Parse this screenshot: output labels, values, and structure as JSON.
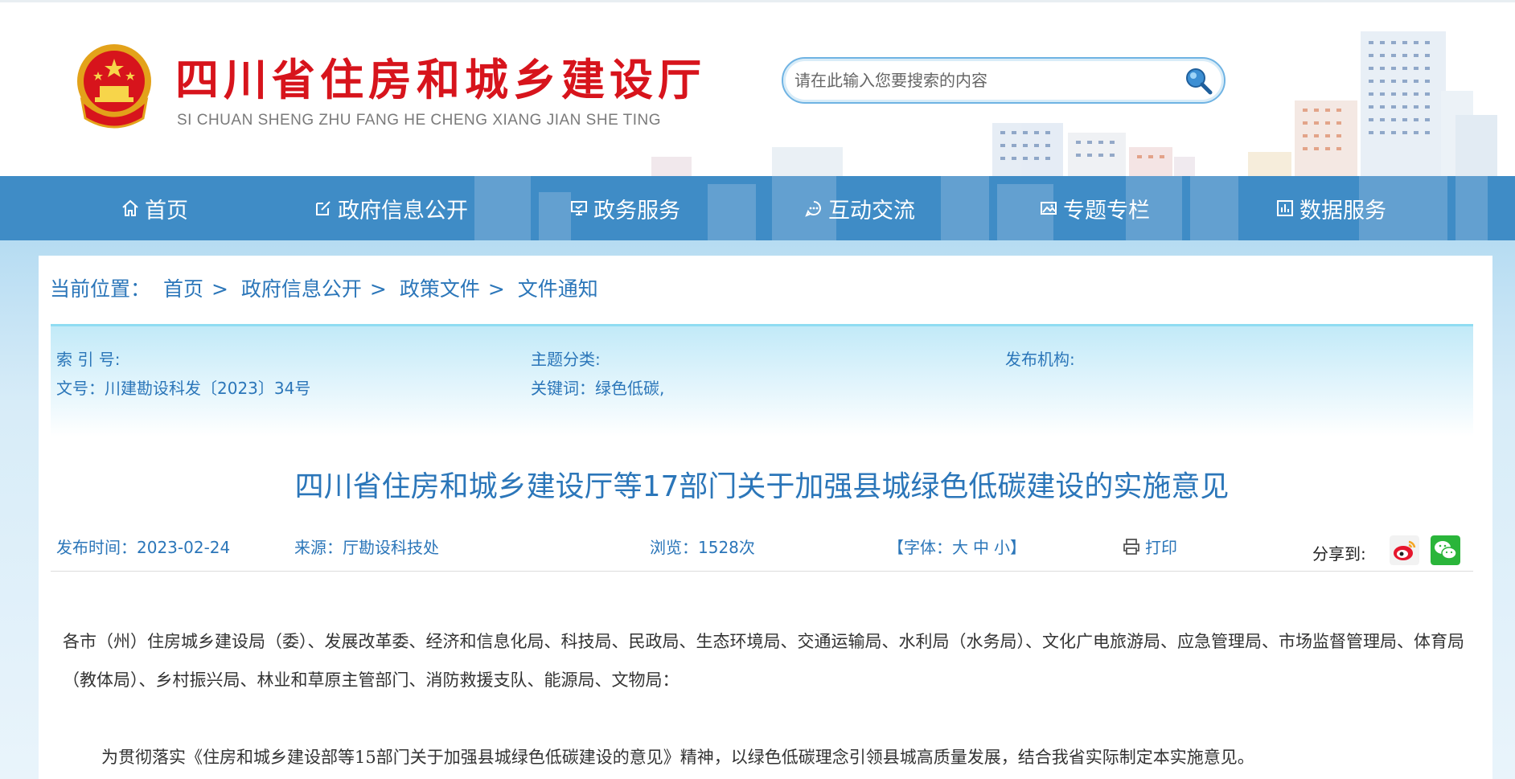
{
  "header": {
    "title": "四川省住房和城乡建设厅",
    "subtitle": "SI CHUAN SHENG ZHU FANG HE CHENG XIANG JIAN SHE TING",
    "search_placeholder": "请在此输入您要搜索的内容",
    "emblem_icon": "national-emblem",
    "search_icon": "magnifier-icon"
  },
  "nav": {
    "items": [
      {
        "label": "首页",
        "icon": "home-icon"
      },
      {
        "label": "政府信息公开",
        "icon": "edit-icon"
      },
      {
        "label": "政务服务",
        "icon": "monitor-icon"
      },
      {
        "label": "互动交流",
        "icon": "chat-icon"
      },
      {
        "label": "专题专栏",
        "icon": "image-icon"
      },
      {
        "label": "数据服务",
        "icon": "chart-icon"
      }
    ]
  },
  "breadcrumb": {
    "prefix": "当前位置：",
    "items": [
      "首页",
      "政府信息公开",
      "政策文件",
      "文件通知"
    ],
    "separator": ">"
  },
  "meta": {
    "index_label": "索 引 号:",
    "topic_label": "主题分类:",
    "publisher_label": "发布机构:",
    "doc_number": "文号：川建勘设科发〔2023〕34号",
    "keywords": "关键词：绿色低碳,"
  },
  "article": {
    "title": "四川省住房和城乡建设厅等17部门关于加强县城绿色低碳建设的实施意见",
    "publish_time": "发布时间：2023-02-24",
    "source": "来源：厅勘设科技处",
    "views": "浏览：1528次",
    "font_size": {
      "prefix": "【字体：",
      "large": "大",
      "medium": "中",
      "small": "小",
      "suffix": "】"
    },
    "print_label": "打印",
    "share_label": "分享到:",
    "paragraph1": "各市（州）住房城乡建设局（委）、发展改革委、经济和信息化局、科技局、民政局、生态环境局、交通运输局、水利局（水务局）、文化广电旅游局、应急管理局、市场监督管理局、体育局（教体局）、乡村振兴局、林业和草原主管部门、消防救援支队、能源局、文物局：",
    "paragraph2": "为贯彻落实《住房和城乡建设部等15部门关于加强县城绿色低碳建设的意见》精神，以绿色低碳理念引领县城高质量发展，结合我省实际制定本实施意见。"
  },
  "colors": {
    "brand_red": "#d7141c",
    "nav_blue": "#3f8cc6",
    "link_blue": "#2b76b9"
  }
}
